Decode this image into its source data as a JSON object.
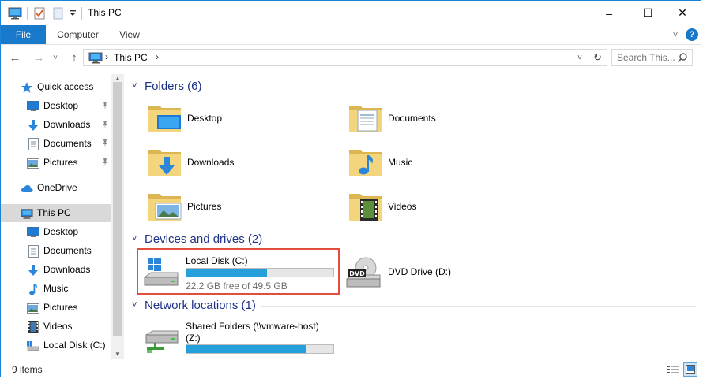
{
  "window": {
    "title": "This PC",
    "accent": "#1979ca",
    "highlight_color": "#e24d3c",
    "progress_color": "#26a0da"
  },
  "quick_access_toolbar": {
    "icons": [
      "computer-icon",
      "properties-checklist-icon",
      "new-folder-icon",
      "customize-dropdown-icon"
    ]
  },
  "caption_buttons": {
    "minimize": "–",
    "maximize": "☐",
    "close": "✕"
  },
  "ribbon": {
    "tabs": [
      "File",
      "Computer",
      "View"
    ],
    "expand_glyph": "˅",
    "help_glyph": "?"
  },
  "nav_bar": {
    "back": "←",
    "forward": "→",
    "recent": "˅",
    "up": "↑",
    "breadcrumb": "This PC",
    "chevron": "›",
    "dropdown": "˅",
    "refresh": "↻",
    "search_placeholder": "Search This..."
  },
  "navigation_pane": {
    "quick_access": {
      "label": "Quick access",
      "items": [
        {
          "label": "Desktop",
          "icon": "desktop-icon",
          "pinned": true
        },
        {
          "label": "Downloads",
          "icon": "downloads-icon",
          "pinned": true
        },
        {
          "label": "Documents",
          "icon": "documents-icon",
          "pinned": true
        },
        {
          "label": "Pictures",
          "icon": "pictures-icon",
          "pinned": true
        }
      ]
    },
    "onedrive": {
      "label": "OneDrive"
    },
    "this_pc": {
      "label": "This PC",
      "selected": true,
      "items": [
        {
          "label": "Desktop",
          "icon": "desktop-icon"
        },
        {
          "label": "Documents",
          "icon": "documents-icon"
        },
        {
          "label": "Downloads",
          "icon": "downloads-icon"
        },
        {
          "label": "Music",
          "icon": "music-icon"
        },
        {
          "label": "Pictures",
          "icon": "pictures-icon"
        },
        {
          "label": "Videos",
          "icon": "videos-icon"
        },
        {
          "label": "Local Disk (C:)",
          "icon": "drive-icon"
        }
      ]
    },
    "pin_glyph": "📌"
  },
  "content": {
    "groups": {
      "folders": {
        "label": "Folders (6)",
        "items": [
          {
            "label": "Desktop",
            "icon": "desktop-folder-icon"
          },
          {
            "label": "Documents",
            "icon": "documents-folder-icon"
          },
          {
            "label": "Downloads",
            "icon": "downloads-folder-icon"
          },
          {
            "label": "Music",
            "icon": "music-folder-icon"
          },
          {
            "label": "Pictures",
            "icon": "pictures-folder-icon"
          },
          {
            "label": "Videos",
            "icon": "videos-folder-icon"
          }
        ]
      },
      "devices": {
        "label": "Devices and drives (2)",
        "items": [
          {
            "label": "Local Disk (C:)",
            "free": "22.2 GB free of 49.5 GB",
            "used_fraction": 0.55,
            "icon": "windows-drive-icon",
            "highlighted": true
          },
          {
            "label": "DVD Drive (D:)",
            "icon": "dvd-drive-icon",
            "badge": "DVD"
          }
        ]
      },
      "network": {
        "label": "Network locations (1)",
        "items": [
          {
            "label_line1": "Shared Folders (\\\\vmware-host)",
            "label_line2": "(Z:)",
            "used_fraction": 0.81,
            "icon": "network-drive-icon"
          }
        ]
      }
    },
    "group_chevron": "˅"
  },
  "status_bar": {
    "item_count": "9 items",
    "views": [
      "details-view-icon",
      "large-icons-view-icon"
    ],
    "active_view": "large-icons-view-icon"
  }
}
